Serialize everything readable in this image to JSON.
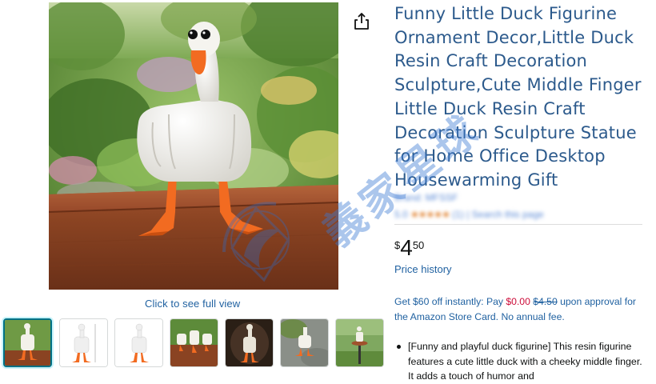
{
  "product": {
    "title": "Funny Little Duck Figurine Ornament Decor,Little Duck Resin Craft Decoration Sculpture,Cute Middle Finger Little Duck Resin Craft Decoration Sculpture Statue for Home Office Desktop Housewarming Gift",
    "brand_text": "Brand: MFSSF",
    "rating_value": "5.0",
    "stars": "★★★★★",
    "rating_count": "(1)",
    "search_text": "Search this page"
  },
  "gallery": {
    "see_full_view": "Click to see full view",
    "thumbnails": [
      {
        "label": "thumb-1",
        "selected": true
      },
      {
        "label": "thumb-2",
        "selected": false
      },
      {
        "label": "thumb-3",
        "selected": false
      },
      {
        "label": "thumb-4",
        "selected": false
      },
      {
        "label": "thumb-5",
        "selected": false
      },
      {
        "label": "thumb-6",
        "selected": false
      },
      {
        "label": "thumb-7",
        "selected": false
      }
    ]
  },
  "price": {
    "symbol": "$",
    "whole": "4",
    "fraction": "50",
    "history_link": "Price history"
  },
  "promo": {
    "prefix": "Get $60 off instantly: Pay ",
    "pay_amount": "$0.00",
    "original_amount": "$4.50",
    "suffix": " upon approval for the Amazon Store Card. No annual fee."
  },
  "bullets": [
    "[Funny and playful duck figurine] This resin figurine features a cute little duck with a cheeky middle finger. It adds a touch of humor and"
  ],
  "watermark_text": "義家星球",
  "colors": {
    "link": "#2162a1",
    "title": "#2c5a8c",
    "price_red": "#cc0c39",
    "selected_thumb": "#007185",
    "duck_orange": "#f26b21"
  },
  "icons": {
    "share": "share-icon"
  }
}
